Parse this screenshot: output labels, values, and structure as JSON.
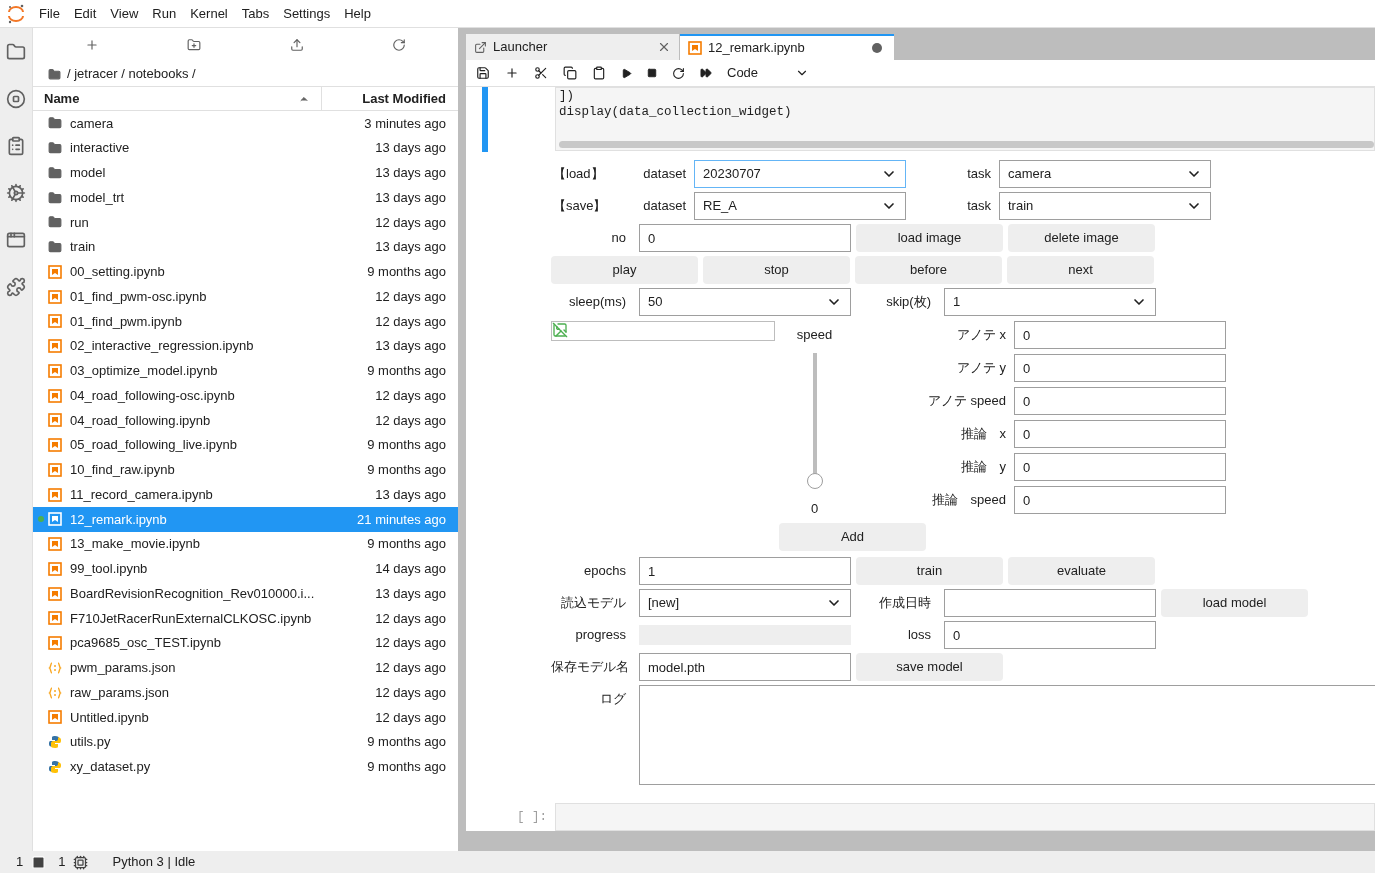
{
  "menu": [
    "File",
    "Edit",
    "View",
    "Run",
    "Kernel",
    "Tabs",
    "Settings",
    "Help"
  ],
  "file_browser": {
    "breadcrumb": "/ jetracer / notebooks /",
    "columns": {
      "name": "Name",
      "modified": "Last Modified"
    },
    "files": [
      {
        "name": "camera",
        "modified": "3 minutes ago",
        "kind": "folder",
        "selected": false,
        "running": false
      },
      {
        "name": "interactive",
        "modified": "13 days ago",
        "kind": "folder",
        "selected": false,
        "running": false
      },
      {
        "name": "model",
        "modified": "13 days ago",
        "kind": "folder",
        "selected": false,
        "running": false
      },
      {
        "name": "model_trt",
        "modified": "13 days ago",
        "kind": "folder",
        "selected": false,
        "running": false
      },
      {
        "name": "run",
        "modified": "12 days ago",
        "kind": "folder",
        "selected": false,
        "running": false
      },
      {
        "name": "train",
        "modified": "13 days ago",
        "kind": "folder",
        "selected": false,
        "running": false
      },
      {
        "name": "00_setting.ipynb",
        "modified": "9 months ago",
        "kind": "notebook",
        "selected": false,
        "running": false
      },
      {
        "name": "01_find_pwm-osc.ipynb",
        "modified": "12 days ago",
        "kind": "notebook",
        "selected": false,
        "running": false
      },
      {
        "name": "01_find_pwm.ipynb",
        "modified": "12 days ago",
        "kind": "notebook",
        "selected": false,
        "running": false
      },
      {
        "name": "02_interactive_regression.ipynb",
        "modified": "13 days ago",
        "kind": "notebook",
        "selected": false,
        "running": false
      },
      {
        "name": "03_optimize_model.ipynb",
        "modified": "9 months ago",
        "kind": "notebook",
        "selected": false,
        "running": false
      },
      {
        "name": "04_road_following-osc.ipynb",
        "modified": "12 days ago",
        "kind": "notebook",
        "selected": false,
        "running": false
      },
      {
        "name": "04_road_following.ipynb",
        "modified": "12 days ago",
        "kind": "notebook",
        "selected": false,
        "running": false
      },
      {
        "name": "05_road_following_live.ipynb",
        "modified": "9 months ago",
        "kind": "notebook",
        "selected": false,
        "running": false
      },
      {
        "name": "10_find_raw.ipynb",
        "modified": "9 months ago",
        "kind": "notebook",
        "selected": false,
        "running": false
      },
      {
        "name": "11_record_camera.ipynb",
        "modified": "13 days ago",
        "kind": "notebook",
        "selected": false,
        "running": false
      },
      {
        "name": "12_remark.ipynb",
        "modified": "21 minutes ago",
        "kind": "notebook",
        "selected": true,
        "running": true
      },
      {
        "name": "13_make_movie.ipynb",
        "modified": "9 months ago",
        "kind": "notebook",
        "selected": false,
        "running": false
      },
      {
        "name": "99_tool.ipynb",
        "modified": "14 days ago",
        "kind": "notebook",
        "selected": false,
        "running": false
      },
      {
        "name": "BoardRevisionRecognition_Rev010000.i...",
        "modified": "13 days ago",
        "kind": "notebook",
        "selected": false,
        "running": false
      },
      {
        "name": "F710JetRacerRunExternalCLKOSC.ipynb",
        "modified": "12 days ago",
        "kind": "notebook",
        "selected": false,
        "running": false
      },
      {
        "name": "pca9685_osc_TEST.ipynb",
        "modified": "12 days ago",
        "kind": "notebook",
        "selected": false,
        "running": false
      },
      {
        "name": "pwm_params.json",
        "modified": "12 days ago",
        "kind": "json",
        "selected": false,
        "running": false
      },
      {
        "name": "raw_params.json",
        "modified": "12 days ago",
        "kind": "json",
        "selected": false,
        "running": false
      },
      {
        "name": "Untitled.ipynb",
        "modified": "12 days ago",
        "kind": "notebook",
        "selected": false,
        "running": false
      },
      {
        "name": "utils.py",
        "modified": "9 months ago",
        "kind": "python",
        "selected": false,
        "running": false
      },
      {
        "name": "xy_dataset.py",
        "modified": "9 months ago",
        "kind": "python",
        "selected": false,
        "running": false
      }
    ]
  },
  "tabs": [
    {
      "label": "Launcher",
      "kind": "launcher",
      "selected": false,
      "unsaved": false
    },
    {
      "label": "12_remark.ipynb",
      "kind": "notebook",
      "selected": true,
      "unsaved": true
    }
  ],
  "cell_type": "Code",
  "code_lines": [
    "])",
    "display(data_collection_widget)"
  ],
  "widget": {
    "load": {
      "tag": "【load】",
      "dataset_label": "dataset",
      "dataset": "20230707",
      "task_label": "task",
      "task": "camera"
    },
    "save": {
      "tag": "【save】",
      "dataset_label": "dataset",
      "dataset": "RE_A",
      "task_label": "task",
      "task": "train"
    },
    "no": {
      "label": "no",
      "value": "0"
    },
    "image_buttons": [
      "load image",
      "delete image"
    ],
    "playback_buttons": [
      "play",
      "stop",
      "before",
      "next"
    ],
    "sleep": {
      "label": "sleep(ms)",
      "value": "50"
    },
    "skip": {
      "label": "skip(枚)",
      "value": "1"
    },
    "speed_slider": {
      "label": "speed",
      "level": 0,
      "reading": "0"
    },
    "add_button": "Add",
    "annotations": [
      {
        "label": "アノテ x",
        "value": "0"
      },
      {
        "label": "アノテ y",
        "value": "0"
      },
      {
        "label": "アノテ speed",
        "value": "0"
      },
      {
        "label": "推論　x",
        "value": "0"
      },
      {
        "label": "推論　y",
        "value": "0"
      },
      {
        "label": "推論　speed",
        "value": "0"
      }
    ],
    "epochs": {
      "label": "epochs",
      "value": "1"
    },
    "train_buttons": [
      "train",
      "evaluate"
    ],
    "model_select": {
      "label": "読込モデル",
      "value": "[new]"
    },
    "created": {
      "label": "作成日時"
    },
    "load_model_button": "load model",
    "progress": {
      "label": "progress",
      "level": 0
    },
    "loss": {
      "label": "loss",
      "value": "0"
    },
    "save_name": {
      "label": "保存モデル名",
      "value": "model.pth"
    },
    "save_model_button": "save model",
    "log": {
      "label": "ログ"
    }
  },
  "empty_cell_prompt": "[ ]:",
  "status_bar": {
    "terminals": "1",
    "kernels": "1",
    "kernel_status": "Python 3 | Idle"
  }
}
